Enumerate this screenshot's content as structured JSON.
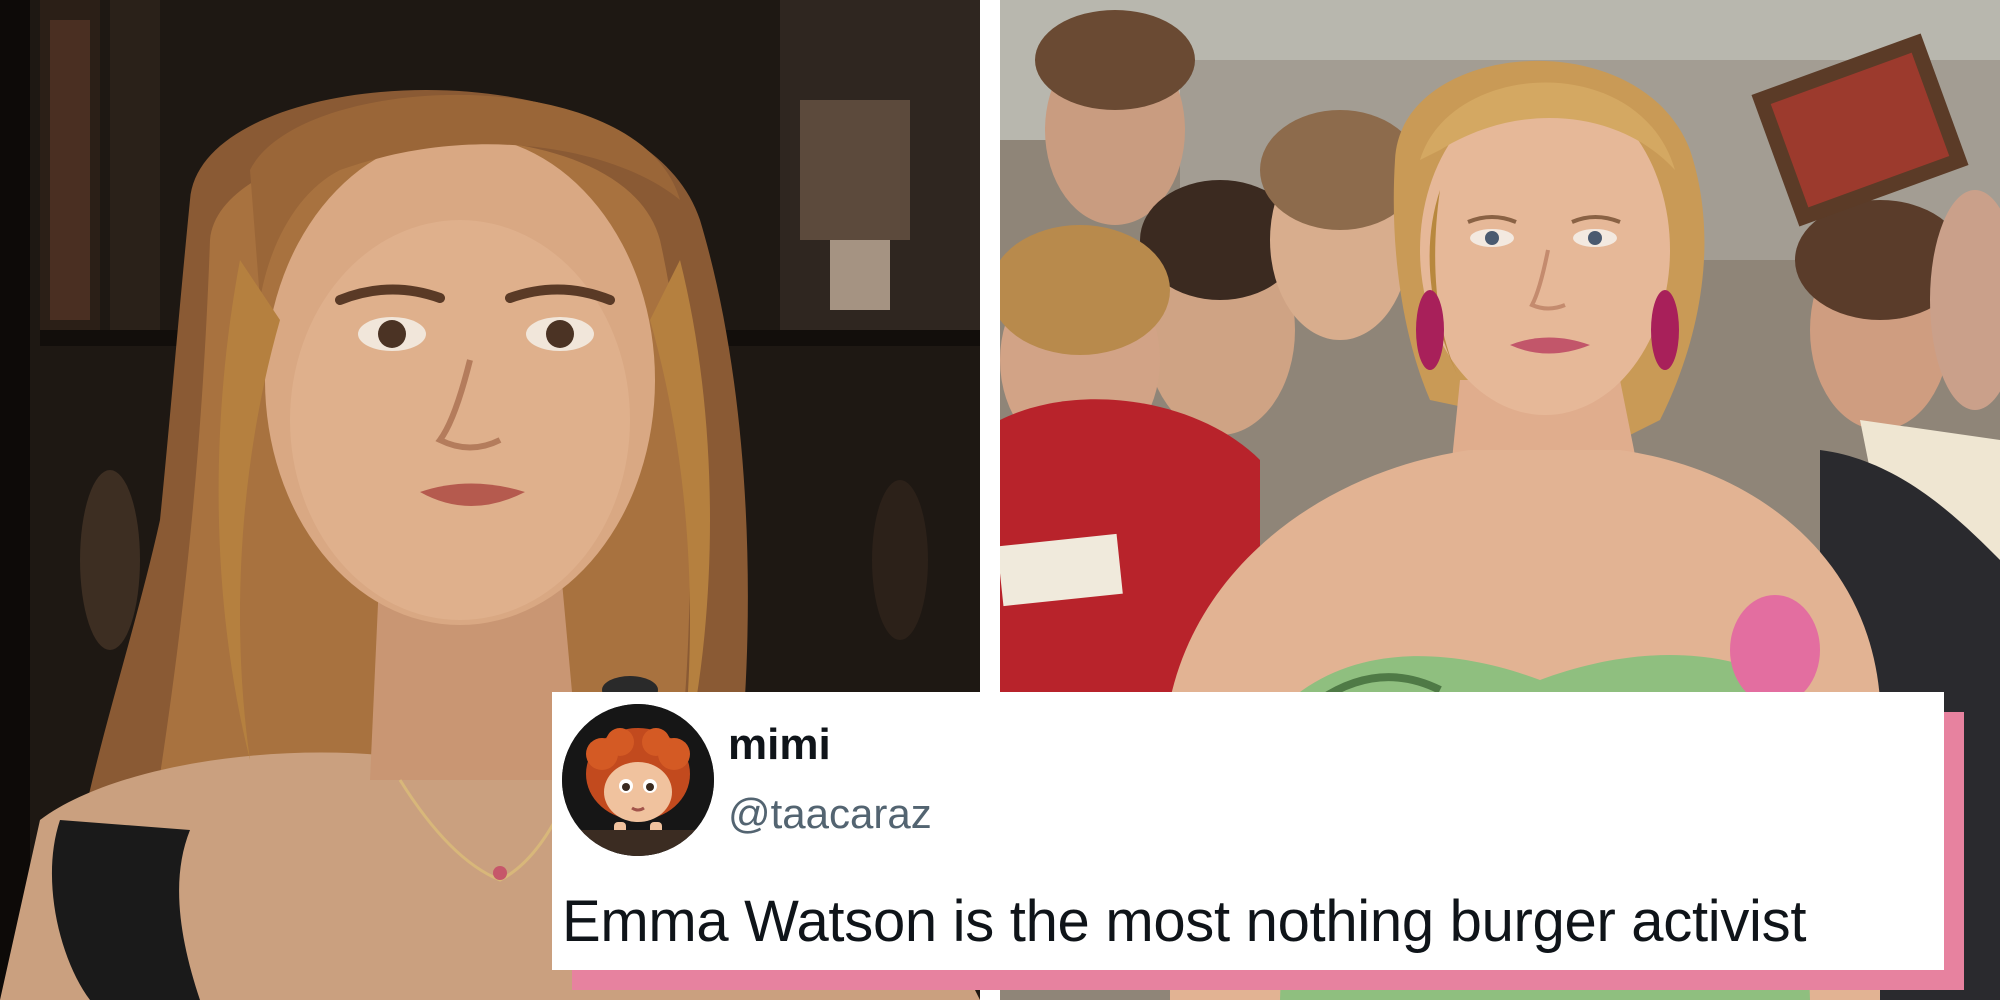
{
  "tweet": {
    "display_name": "mimi",
    "handle": "@taacaraz",
    "text": "Emma Watson is the most nothing burger activist",
    "accent_border_color": "#e7829f"
  },
  "photos": {
    "left": {
      "subject": "woman-portrait-photo"
    },
    "right": {
      "subject": "woman-at-premiere-photo"
    }
  },
  "icons": {
    "avatar": "cartoon-character-avatar"
  }
}
